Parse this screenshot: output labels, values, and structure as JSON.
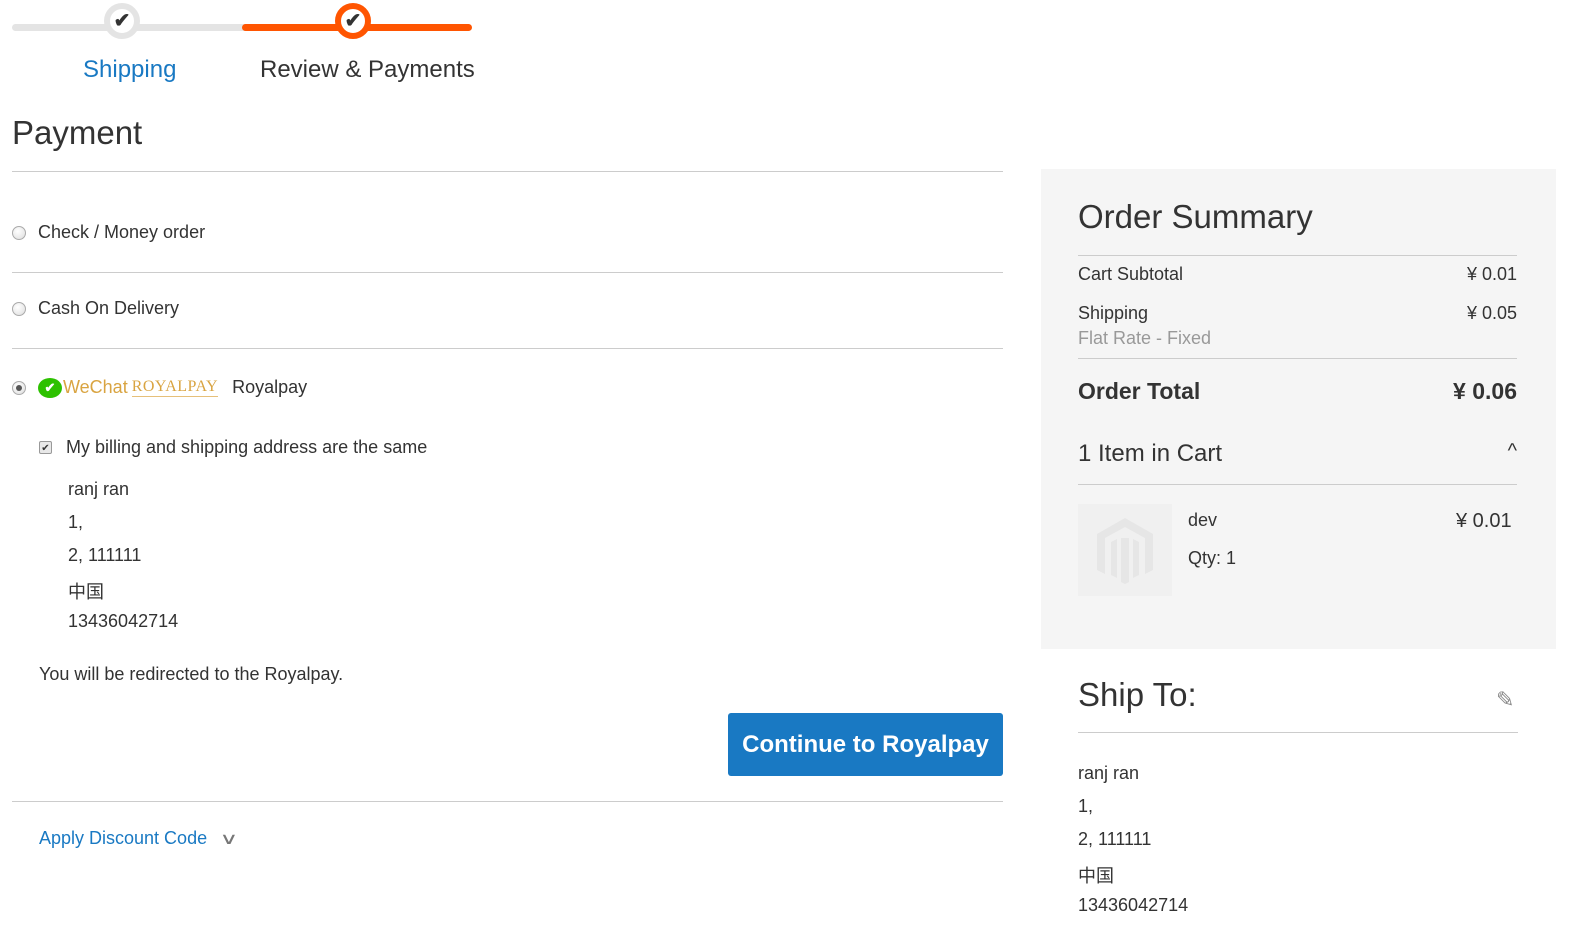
{
  "progress": {
    "steps": [
      {
        "label": "Shipping",
        "state": "complete",
        "icon": "check-icon"
      },
      {
        "label": "Review & Payments",
        "state": "active",
        "icon": "check-icon"
      }
    ],
    "check_glyph": "✔"
  },
  "payment": {
    "title": "Payment",
    "methods": [
      {
        "label": "Check / Money order",
        "selected": false
      },
      {
        "label": "Cash On Delivery",
        "selected": false
      },
      {
        "label": "Royalpay",
        "selected": true,
        "logo": {
          "wechat": "WeChat",
          "royal": "ROYALPAY",
          "bubble": "✔"
        }
      }
    ],
    "billing_same_label": "My billing and shipping address are the same",
    "billing_same_checked": true,
    "check_glyph": "✔",
    "address": [
      "ranj ran",
      "1,",
      "2, 111111",
      "中国",
      "13436042714"
    ],
    "redirect_note": "You will be redirected to the Royalpay.",
    "continue_button": "Continue to Royalpay",
    "discount_link": "Apply Discount Code",
    "discount_chevron": "∨"
  },
  "summary": {
    "title": "Order Summary",
    "rows": [
      {
        "label": "Cart Subtotal",
        "value": "¥ 0.01"
      },
      {
        "label": "Shipping",
        "value": "¥ 0.05",
        "sub": "Flat Rate - Fixed"
      }
    ],
    "total": {
      "label": "Order Total",
      "value": "¥ 0.06"
    },
    "items_header": "1 Item in Cart",
    "items_chevron": "^",
    "items": [
      {
        "name": "dev",
        "qty": "Qty: 1",
        "price": "¥ 0.01"
      }
    ]
  },
  "ship_to": {
    "title": "Ship To:",
    "edit_glyph": "✎",
    "address": [
      "ranj ran",
      "1,",
      "2, 111111",
      "中国",
      "13436042714"
    ]
  },
  "colors": {
    "accent": "#1979c3",
    "progress_active": "#ff5501",
    "progress_inactive": "#e4e4e4",
    "wechat_green": "#2dc100",
    "royalpay_gold": "#d9a441"
  }
}
